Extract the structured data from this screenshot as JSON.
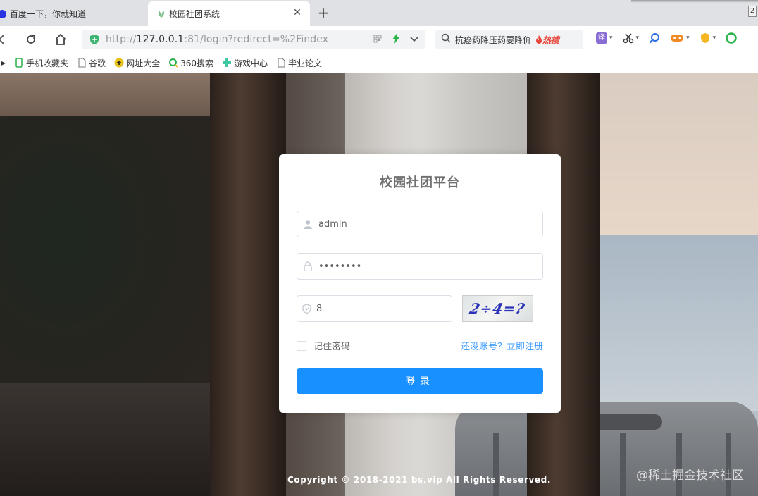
{
  "browser": {
    "tabs": [
      {
        "label": "百度一下，你就知道"
      },
      {
        "label": "校园社团系统"
      }
    ],
    "tab_count": "2",
    "address": {
      "scheme_host": "http://",
      "host": "127.0.0.1",
      "rest": ":81/login?redirect=%2Findex"
    },
    "search_query": "抗癌药降压药要降价",
    "search_hot": "热搜",
    "tools": {
      "translate": "译"
    },
    "bookmarks": [
      {
        "label": "手机收藏夹"
      },
      {
        "label": "谷歌"
      },
      {
        "label": "网址大全"
      },
      {
        "label": "360搜索"
      },
      {
        "label": "游戏中心"
      },
      {
        "label": "毕业论文"
      }
    ]
  },
  "login": {
    "title": "校园社团平台",
    "username": "admin",
    "password": "••••••••",
    "code": "8",
    "captcha_text": "2÷4=?",
    "remember_label": "记住密码",
    "register_link": "还没账号？立即注册",
    "submit_label": "登录"
  },
  "footer": {
    "copyright": "Copyright © 2018-2021 bs.vip All Rights Reserved.",
    "watermark": "@稀土掘金技术社区"
  },
  "colors": {
    "primary": "#1890ff",
    "link": "#409eff"
  }
}
